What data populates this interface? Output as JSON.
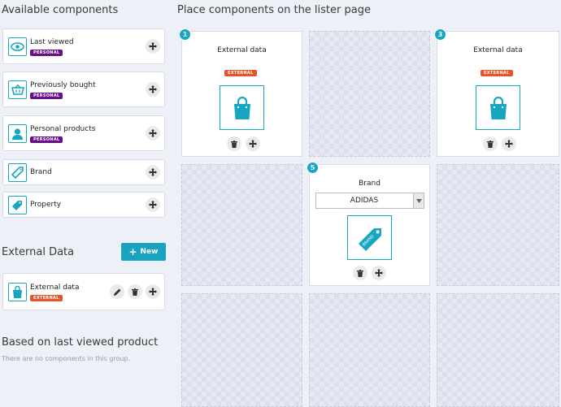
{
  "left": {
    "title": "Available components",
    "components": [
      {
        "label": "Last viewed",
        "badge": "PERSONAL",
        "icon": "eye-icon"
      },
      {
        "label": "Previously bought",
        "badge": "PERSONAL",
        "icon": "basket-icon"
      },
      {
        "label": "Personal products",
        "badge": "PERSONAL",
        "icon": "user-icon"
      },
      {
        "label": "Brand",
        "icon": "tag-icon"
      },
      {
        "label": "Property",
        "icon": "label-icon"
      }
    ],
    "external_section": {
      "title": "External Data",
      "new_button": "New",
      "items": [
        {
          "label": "External data",
          "badge": "EXTERNAL",
          "icon": "shopping-bag-icon"
        }
      ]
    },
    "based_section": {
      "title": "Based on last viewed product",
      "empty_text": "There are no components in this group."
    }
  },
  "right": {
    "title": "Place components on the lister page",
    "placed": [
      {
        "number": "1",
        "title": "External data",
        "badge": "EXTERNAL",
        "icon": "shopping-bag-icon"
      },
      {
        "number": "3",
        "title": "External data",
        "badge": "EXTERNAL",
        "icon": "shopping-bag-icon"
      },
      {
        "number": "5",
        "title": "Brand",
        "select_value": "ADIDAS",
        "icon": "brand-tag-icon",
        "tag_text": "BRAND"
      }
    ]
  },
  "colors": {
    "accent": "#16a6c2",
    "personal": "#6a0d8a",
    "external": "#e8542a"
  }
}
